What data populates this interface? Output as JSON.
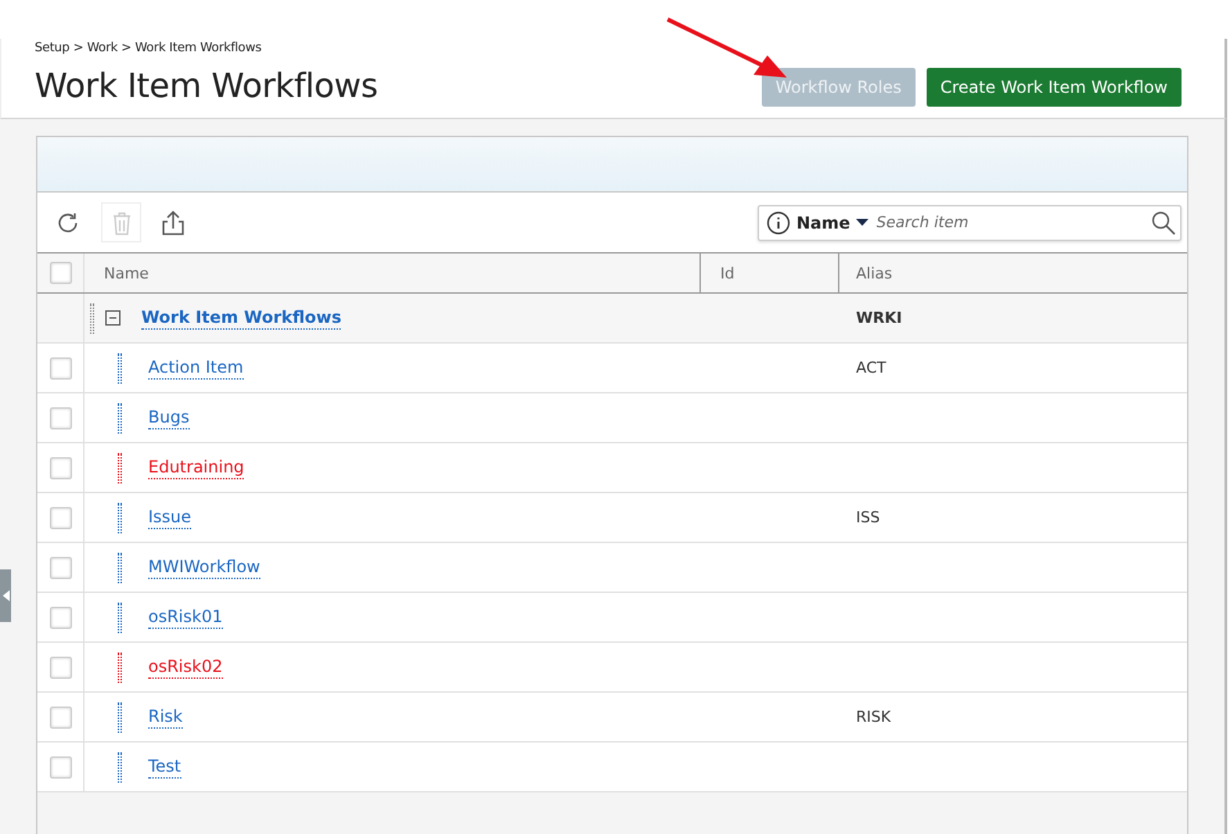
{
  "breadcrumb": "Setup > Work > Work Item Workflows",
  "title": "Work Item Workflows",
  "buttons": [
    {
      "label": "Workflow Roles",
      "kind": "secondary"
    },
    {
      "label": "Create Work Item Workflow",
      "kind": "primary"
    }
  ],
  "search": {
    "field": "Name",
    "placeholder": "Search item"
  },
  "table": {
    "select_all": {
      "checked": false
    },
    "columns": [
      "Name",
      "Id",
      "Alias"
    ],
    "group": {
      "name": "Work Item Workflows",
      "alias": "WRKI",
      "expanded": true
    },
    "rows": [
      {
        "name": "Action Item",
        "alias": "ACT",
        "color": "#1a66c2",
        "checked": false
      },
      {
        "name": "Bugs",
        "color": "#1a66c2",
        "checked": false
      },
      {
        "name": "Edutraining",
        "color": "#e8101a",
        "checked": false
      },
      {
        "name": "Issue",
        "alias": "ISS",
        "color": "#1a66c2",
        "checked": false
      },
      {
        "name": "MWIWorkflow",
        "color": "#1a66c2",
        "checked": false
      },
      {
        "name": "osRisk01",
        "color": "#1a66c2",
        "checked": false
      },
      {
        "name": "osRisk02",
        "color": "#e8101a",
        "checked": false
      },
      {
        "name": "Risk",
        "alias": "RISK",
        "color": "#1a66c2",
        "checked": false
      },
      {
        "name": "Test",
        "color": "#1a66c2",
        "checked": false
      }
    ]
  }
}
